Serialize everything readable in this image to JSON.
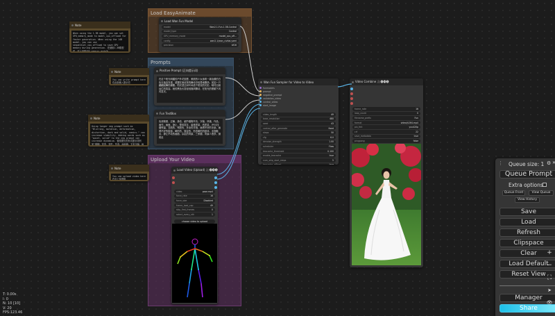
{
  "colors": {
    "group_easyanimate": "#6b4a2d",
    "group_prompts": "#33475b",
    "group_upload": "#5a2f5c",
    "link_cyan": "#5ab4e8",
    "link_white": "#d0d0d0",
    "share_gradient_start": "#1ec0e8",
    "share_gradient_end": "#7ee8fa"
  },
  "groups": {
    "easyanimate": {
      "title": "Load EasyAnimate"
    },
    "prompts": {
      "title": "Prompts"
    },
    "upload": {
      "title": "Upload Your Video"
    }
  },
  "notes": {
    "note1": {
      "title": "Note",
      "text": "When using the 1.3B model, you can set GPU_memory_mode to model_cpu_offload for faster generation. When using the 14B model, you can use sequential_cpu_offload to save GPU memory during generation. 在使用1.3B模型时，可以设置GPU_memory_mode为model_cpu_offload以获得更快的生成速度。在使用14B模型时，可以使用sequential_cpu_offload来节省生成过程中的显存。"
    },
    "note2": {
      "title": "Note",
      "text": "You can write prompt here 在此处输入提示词"
    },
    "note3": {
      "title": "Note",
      "text": "Using longer neg prompt such as \"Blurring, mutation, deformation, distortion, dark and solid, comics.\" can increase stability. Adding words such as \"quiet, solid\" to the neg prompt can increase dynamism. 使用更长的负向提示词例如\"模糊，突变，变形，失真，画面暗，文本字幕，画面固定，连环画，漫画，线稿，没有主体\"可以增加稳定性。在负向提示词中添加\"安静，固定\"等词语可以增加动态性。"
    },
    "note4": {
      "title": "Note",
      "text": "You can upload video here 在此上传视频"
    }
  },
  "nodes": {
    "load_model": {
      "title": "Load Wan Fun Model",
      "widgets": [
        {
          "label": "model",
          "value": "Wan2.1-Fun-1.3B-Control"
        },
        {
          "label": "model_type",
          "value": "Control"
        },
        {
          "label": "GPU_memory_mode",
          "value": "model_cpu_off..."
        },
        {
          "label": "config",
          "value": "wan2.1/wan_civitai.yaml"
        },
        {
          "label": "precision",
          "value": "bf16"
        }
      ]
    },
    "positive_prompt": {
      "title": "Positive Prompt (正向提示词)",
      "text": "在这个阳光明媚的户外花园里，美丽的少女身着一袭及膝的白色无袖连衣裙，裙摆在她欢快的舞动中轻柔地飘扬，宛如一只翩翩起舞的蝴蝶。阳光透过树叶间洒下斑驳的光影，映衬出她灿烂的笑容。她的黑色长发轻轻随风飘动，在阳光的照耀下闪闪发光。"
    },
    "negative_prompt": {
      "title": "Fun TextBox",
      "text": "色调艳丽，过曝，静态，细节模糊不清，字幕，风格，作品，画作，画面，静止，整体发灰，最差质量，低质量，JPEG压缩残留，丑陋的，残缺的，多余的手指，画得不好的手部，画得不好的脸部，畸形的，毁容的，形态畸形的肢体，手指融合，静止不动的画面，杂乱的背景，三条腿，背景人很多，倒着走"
    },
    "sampler": {
      "title": "Wan Fun Sampler for Video to Video",
      "sockets": [
        "funmodels",
        "prompt",
        "negative_prompt",
        "validation_video",
        "control_video",
        "start_image"
      ],
      "widgets": [
        {
          "label": "video_length",
          "value": "49"
        },
        {
          "label": "base_resolution",
          "value": "480"
        },
        {
          "label": "seed",
          "value": "43"
        },
        {
          "label": "control_after_generate",
          "value": "fixed"
        },
        {
          "label": "steps",
          "value": "50"
        },
        {
          "label": "cfg",
          "value": "6.0"
        },
        {
          "label": "denoise_strength",
          "value": "1.00"
        },
        {
          "label": "scheduler",
          "value": "Flow"
        },
        {
          "label": "teacache_threshold",
          "value": "0.100"
        },
        {
          "label": "enable_teacache",
          "value": "true"
        },
        {
          "label": "num_skip_start_steps",
          "value": "5"
        },
        {
          "label": "teacache_offload",
          "value": "true"
        }
      ]
    },
    "video_combine": {
      "title": "Video Combine 🎥🅥🅗🅢",
      "widgets": [
        {
          "label": "frame_rate",
          "value": "16"
        },
        {
          "label": "loop_count",
          "value": "0"
        },
        {
          "label": "filename_prefix",
          "value": "Fun"
        },
        {
          "label": "format",
          "value": "video/h264-mp4"
        },
        {
          "label": "pix_fmt",
          "value": "yuv420p"
        },
        {
          "label": "crf",
          "value": "22"
        },
        {
          "label": "save_metadata",
          "value": "true"
        },
        {
          "label": "pingpong",
          "value": "false"
        },
        {
          "label": "save_output",
          "value": "true"
        }
      ]
    },
    "load_video": {
      "title": "Load Video (Upload) 🎥🅥🅗🅢",
      "widgets": [
        {
          "label": "video",
          "value": "pose.mp4"
        },
        {
          "label": "force_rate",
          "value": "16"
        },
        {
          "label": "force_size",
          "value": "Disabled"
        },
        {
          "label": "frame_load_cap",
          "value": "49"
        },
        {
          "label": "skip_first_frames",
          "value": "0"
        },
        {
          "label": "select_every_nth",
          "value": "1"
        }
      ],
      "upload_label": "choose video to upload"
    }
  },
  "status": {
    "lines": [
      "T: 0.00s",
      "I: 0",
      "N: 10 [10]",
      "V: 20",
      "FPS:123.46"
    ]
  },
  "queue_panel": {
    "queue_size": "Queue size: 1",
    "queue_prompt": "Queue Prompt",
    "extra_options": "Extra options",
    "queue_front": "Queue Front",
    "view_queue": "View Queue",
    "view_history": "View History",
    "save": "Save",
    "load": "Load",
    "refresh": "Refresh",
    "clipspace": "Clipspace",
    "clear": "Clear",
    "load_default": "Load Default",
    "reset_view": "Reset View",
    "manager": "Manager",
    "share": "Share"
  },
  "icons": {
    "drag_handle": "⋮",
    "settings": "⚙",
    "close": "✕",
    "zoom_in": "+",
    "zoom_out": "−",
    "fit_view": "⛶",
    "arrow": "➤",
    "eye": "👁"
  }
}
